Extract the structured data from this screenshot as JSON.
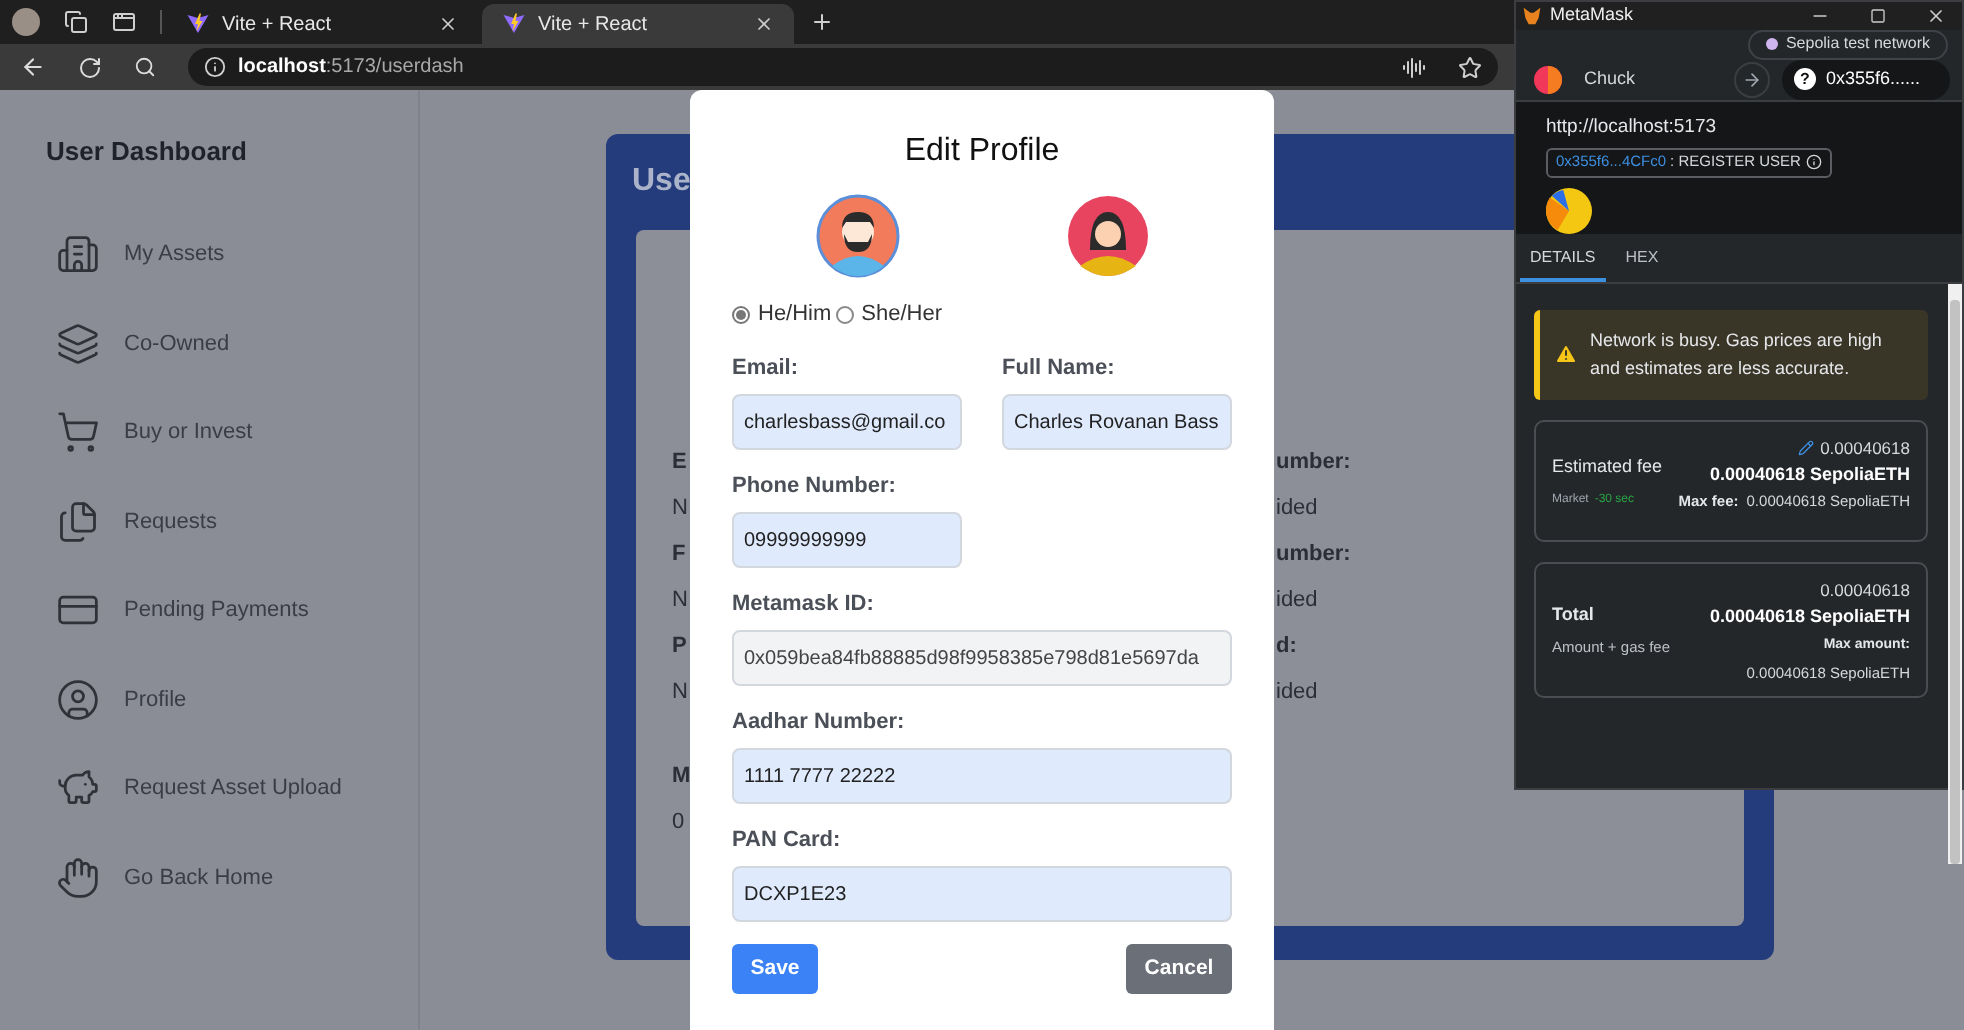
{
  "browser": {
    "tabs": [
      {
        "title": "Vite + React",
        "selected": false
      },
      {
        "title": "Vite + React",
        "selected": true
      }
    ],
    "address": "**localhost**:5173/userdash"
  },
  "sidebar": {
    "title": "User Dashboard",
    "items": [
      {
        "label": "My Assets"
      },
      {
        "label": "Co-Owned"
      },
      {
        "label": "Buy or Invest"
      },
      {
        "label": "Requests"
      },
      {
        "label": "Pending Payments"
      },
      {
        "label": "Profile"
      },
      {
        "label": "Request Asset Upload"
      },
      {
        "label": "Go Back Home"
      }
    ]
  },
  "dashboard_card": {
    "title": "Use",
    "left_column": [
      "E",
      "N",
      "F",
      "N",
      "P",
      "N",
      "M",
      "0"
    ],
    "right_column": [
      "umber:",
      "ided",
      "umber:",
      "ided",
      "d:",
      "ided"
    ]
  },
  "modal": {
    "title": "Edit Profile",
    "pronouns": [
      {
        "label": "He/Him",
        "selected": true
      },
      {
        "label": "She/Her",
        "selected": false
      }
    ],
    "fields": [
      {
        "label": "Email:",
        "value": "charlesbass@gmail.co",
        "disabled": false
      },
      {
        "label": "Full Name:",
        "value": "Charles Rovanan Bass",
        "disabled": false
      },
      {
        "label": "Phone Number:",
        "value": "09999999999",
        "disabled": false
      },
      {
        "label": "Metamask ID:",
        "value": "0x059bea84fb88885d98f9958385e798d81e5697da",
        "disabled": true
      },
      {
        "label": "Aadhar Number:",
        "value": "1111 7777 22222",
        "disabled": false
      },
      {
        "label": "PAN Card:",
        "value": "DCXP1E23",
        "disabled": false
      }
    ],
    "buttons": [
      {
        "label": "Save",
        "kind": "primary"
      },
      {
        "label": "Cancel",
        "kind": "secondary"
      }
    ]
  },
  "metamask": {
    "title": "MetaMask",
    "network": "Sepolia test network",
    "account": "Chuck",
    "to_badge": "?",
    "to_address": "0x355f6......",
    "origin": "http://localhost:5173",
    "contract_address": "0x355f6...4CFc0",
    "method": ": REGISTER USER",
    "tabs": [
      {
        "label": "DETAILS",
        "selected": true
      },
      {
        "label": "HEX",
        "selected": false
      }
    ],
    "warning": "Network is busy. Gas prices are high and estimates are less accurate.",
    "estimated_fee": {
      "label": "Estimated fee",
      "amount": "0.00040618",
      "amount_eth": "0.00040618 SepoliaETH",
      "speed": "Market",
      "time": "-30 sec",
      "max_label": "Max fee:",
      "max_value": "0.00040618 SepoliaETH"
    },
    "total": {
      "label": "Total",
      "amount": "0.00040618",
      "amount_eth": "0.00040618 SepoliaETH",
      "sublabel": "Amount + gas fee",
      "max_label": "Max amount:",
      "max_value": "0.00040618 SepoliaETH"
    }
  }
}
